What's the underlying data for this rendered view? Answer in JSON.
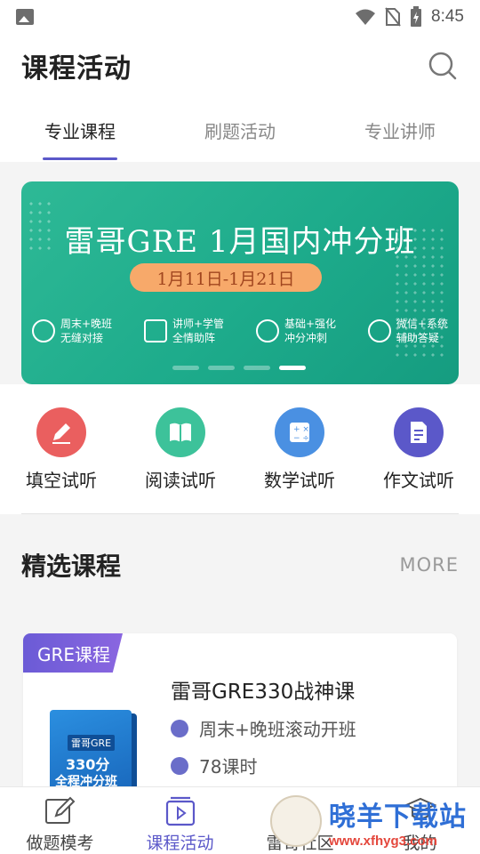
{
  "status_bar": {
    "time": "8:45"
  },
  "header": {
    "title": "课程活动"
  },
  "tabs": [
    {
      "label": "专业课程",
      "active": true
    },
    {
      "label": "刷题活动",
      "active": false
    },
    {
      "label": "专业讲师",
      "active": false
    }
  ],
  "banner": {
    "title": "雷哥GRE 1月国内冲分班",
    "date": "1月11日-1月21日",
    "features": [
      {
        "icon": "clock-icon",
        "text": "周末+晚班\n无缝对接"
      },
      {
        "icon": "teacher-icon",
        "text": "讲师+学管\n全情助阵"
      },
      {
        "icon": "rocket-icon",
        "text": "基础+强化\n冲分冲刺"
      },
      {
        "icon": "people-icon",
        "text": "微信+系统\n辅助答疑"
      }
    ],
    "active_index": 3,
    "page_count": 4,
    "color": "#1dab8b"
  },
  "quick_entries": [
    {
      "label": "填空试听",
      "icon": "pencil-icon",
      "color": "#ea5f5f"
    },
    {
      "label": "阅读试听",
      "icon": "book-icon",
      "color": "#3dc29a"
    },
    {
      "label": "数学试听",
      "icon": "calculator-icon",
      "color": "#4a90e2"
    },
    {
      "label": "作文试听",
      "icon": "essay-icon",
      "color": "#5b58c9"
    }
  ],
  "featured": {
    "title": "精选课程",
    "more": "MORE"
  },
  "course": {
    "tag": "GRE课程",
    "name": "雷哥GRE330战神课",
    "schedule": "周末+晚班滚动开班",
    "lessons": "78课时",
    "cover": {
      "line1": "雷哥GRE",
      "line2": "330分",
      "line3": "全程冲分班"
    }
  },
  "bottom_nav": [
    {
      "label": "做题模考",
      "icon": "exam-icon",
      "active": false
    },
    {
      "label": "课程活动",
      "icon": "video-icon",
      "active": true
    },
    {
      "label": "雷哥社区",
      "icon": "community-icon",
      "active": false
    },
    {
      "label": "我的",
      "icon": "profile-icon",
      "active": false
    }
  ],
  "watermark": {
    "text": "晓羊下载站",
    "url": "www.xfhyg3.com"
  },
  "colors": {
    "accent": "#5b58c9",
    "banner": "#1dab8b"
  }
}
